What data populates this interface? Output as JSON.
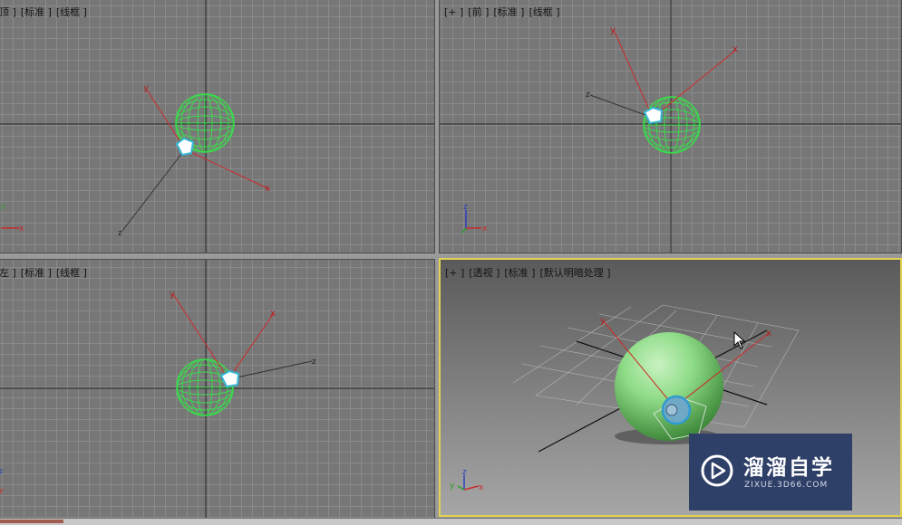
{
  "viewports": {
    "top": {
      "label": [
        "顶 ]",
        "[标准 ]",
        "[线框 ]"
      ]
    },
    "front": {
      "label": [
        "[+ ]",
        "[前 ]",
        "[标准 ]",
        "[线框 ]"
      ]
    },
    "left": {
      "label": [
        "左 ]",
        "[标准 ]",
        "[线框 ]"
      ]
    },
    "persp": {
      "label": [
        "[+ ]",
        "[透视 ]",
        "[标准 ]",
        "[默认明暗处理 ]"
      ]
    }
  },
  "axes": {
    "x": "x",
    "y": "y",
    "z": "z"
  },
  "colors": {
    "viewport_bg": "#777777",
    "grid": "#8a8a8a",
    "sphere_wire": "#3adb4c",
    "active_border": "#e2d24e",
    "x_axis": "#cc2b2b",
    "y_axis": "#2aa02a",
    "z_axis": "#2a3fbf"
  },
  "watermark": {
    "title": "溜溜自学",
    "subtitle": "ZIXUE.3D66.COM",
    "logo_icon": "play-circle-icon"
  },
  "cursor_icon": "arrow-cursor-icon"
}
